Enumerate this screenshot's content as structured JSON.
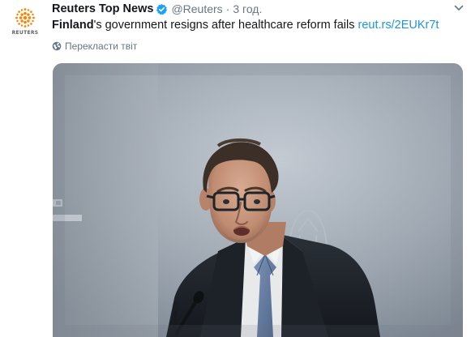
{
  "tweet": {
    "author_name": "Reuters Top News",
    "handle": "@Reuters",
    "separator": "·",
    "time": "3 год.",
    "text_highlight": "Finland",
    "text_rest": "'s government resigns after healthcare reform fails",
    "link": "reut.rs/2EUKr7t",
    "translate_label": "Перекласти твіт"
  },
  "avatar": {
    "logo_word": "REUTERS",
    "brand_color": "#ff8000"
  },
  "icons": {
    "verified": "verified-badge-icon",
    "caret": "chevron-down-icon",
    "globe": "globe-icon"
  },
  "colors": {
    "link": "#1b95e0",
    "secondary_text": "#657786",
    "verified": "#1da1f2"
  }
}
